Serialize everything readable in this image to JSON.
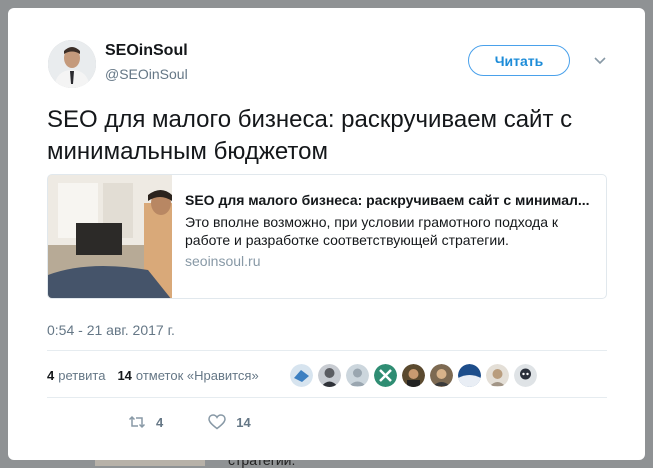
{
  "author": {
    "name": "SEOinSoul",
    "handle": "@SEOinSoul"
  },
  "follow_label": "Читать",
  "tweet": {
    "text": "SEO для малого бизнеса: раскручиваем сайт с минимальным бюджетом",
    "timestamp": "0:54 - 21 авг. 2017 г."
  },
  "link_card": {
    "title": "SEO для малого бизнеса: раскручиваем сайт с минимал...",
    "description": "Это вполне возможно, при условии грамотного подхода к работе и разработке соответствующей стратегии.",
    "domain": "seoinsoul.ru"
  },
  "stats": {
    "retweets_count": "4",
    "retweets_label": "ретвита",
    "likes_count": "14",
    "likes_label": "отметок «Нравится»"
  },
  "actions": {
    "reply_count": "",
    "retweet_count": "4",
    "like_count": "14"
  },
  "background": {
    "peek_text": "стратегии."
  },
  "colors": {
    "accent": "#1d8cd8",
    "text": "#14171a",
    "muted": "#657786",
    "border": "#e1e8ed"
  },
  "likers": [
    "liker-1",
    "liker-2",
    "liker-3",
    "liker-4",
    "liker-5",
    "liker-6",
    "liker-7",
    "liker-8",
    "liker-9"
  ]
}
